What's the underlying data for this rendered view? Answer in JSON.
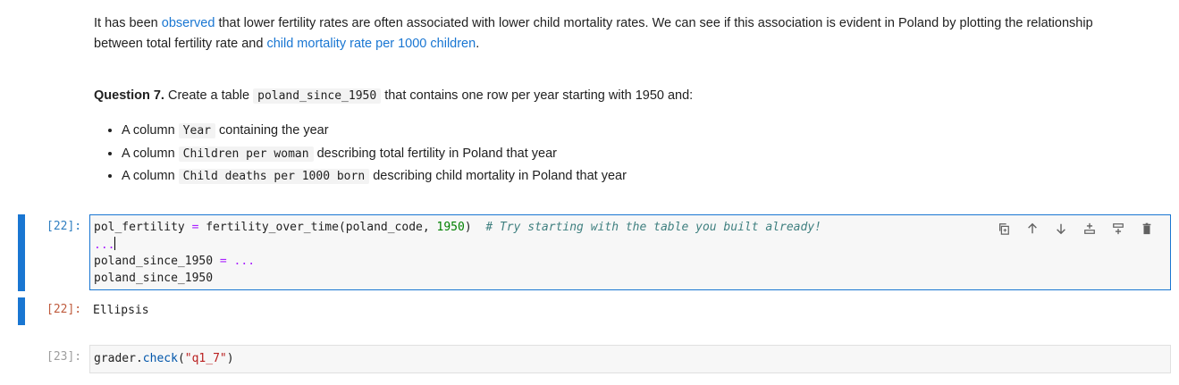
{
  "markdown": {
    "para1": {
      "text_a": "It has been ",
      "link_observed": "observed",
      "text_b": " that lower fertility rates are often associated with lower child mortality rates. We can see if this association is evident in Poland by plotting the relationship between total fertility rate and ",
      "link_child_mortality": "child mortality rate per 1000 children",
      "text_c": "."
    },
    "question": {
      "label": "Question 7.",
      "text_a": " Create a table ",
      "code_table": "poland_since_1950",
      "text_b": " that contains one row per year starting with 1950 and:"
    },
    "bullets": [
      {
        "prefix": "A column ",
        "code": "Year",
        "suffix": " containing the year"
      },
      {
        "prefix": "A column ",
        "code": "Children per woman",
        "suffix": " describing total fertility in Poland that year"
      },
      {
        "prefix": "A column ",
        "code": "Child deaths per 1000 born",
        "suffix": " describing child mortality in Poland that year"
      }
    ]
  },
  "cells": {
    "cell22": {
      "prompt": "[22]:",
      "line1": {
        "var": "pol_fertility",
        "eq": "=",
        "call": "fertility_over_time(poland_code, ",
        "num": "1950",
        "close": ")",
        "comment": "# Try starting with the table you built already!"
      },
      "line2": "...",
      "line3": {
        "var": "poland_since_1950",
        "eq": "=",
        "rest": "..."
      },
      "line4": "poland_since_1950",
      "toolbar": [
        "copy-icon",
        "move-up-icon",
        "move-down-icon",
        "insert-above-icon",
        "insert-below-icon",
        "delete-icon"
      ]
    },
    "out22": {
      "prompt": "[22]:",
      "text": "Ellipsis"
    },
    "cell23": {
      "prompt": "[23]:",
      "obj": "grader",
      "dot": ".",
      "method": "check",
      "open": "(",
      "arg": "\"q1_7\"",
      "close": ")"
    }
  }
}
